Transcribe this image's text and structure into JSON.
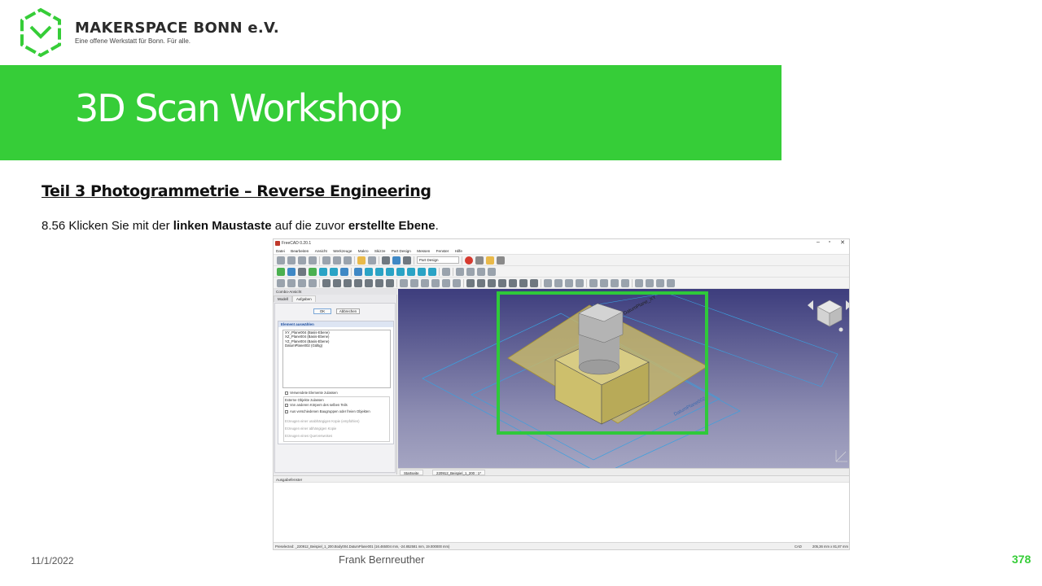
{
  "brand": {
    "name": "MAKERSPACE BONN e.V.",
    "tagline": "Eine offene Werkstatt für Bonn. Für alle.",
    "accent_color": "#36cd38"
  },
  "slide": {
    "title": "3D Scan Workshop",
    "section_heading": "Teil 3  Photogrammetrie  – Reverse Engineering",
    "instruction": {
      "part1": "8.56 Klicken Sie mit der ",
      "bold1": "linken Maustaste",
      "part2": " auf die zuvor ",
      "bold2": "erstellte Ebene",
      "part3": "."
    }
  },
  "footer": {
    "date": "11/1/2022",
    "author": "Frank Bernreuther",
    "page": "378"
  },
  "app": {
    "title": "FreeCAD 0.20.1",
    "window_buttons": [
      "–",
      "▫",
      "✕"
    ],
    "menu": [
      "Datei",
      "Bearbeiten",
      "Ansicht",
      "Werkzeuge",
      "Makro",
      "Skizze",
      "Part Design",
      "Messen",
      "Fenster",
      "Hilfe"
    ],
    "workbench": "Part Design",
    "combo_view": {
      "header": "Combo-Ansicht",
      "tabs": [
        "Modell",
        "Aufgaben"
      ],
      "ok_label": "OK",
      "cancel_label": "Abbrechen",
      "panel_title": "Element auswählen",
      "elements": [
        "XY_Plane004 (Basis-Ebene)",
        "XZ_Plane004 (Basis-Ebene)",
        "YZ_Plane004 (Basis-Ebene)",
        "DatumPlane002 (Gültig)"
      ],
      "unused_checkbox": "Verwendete Elemente zulassen",
      "external_label": "Externe Objekte zulassen",
      "other_bodies": "Von anderen Körpern des selben Teils",
      "other_parts": "Aus verschiedenen Baugruppen oder freien Objekten",
      "option_independent": "Erzeugen einer unabhängigen Kopie (empfohlen)",
      "option_dependent": "Erzeugen einer abhängigen Kopie",
      "option_crossref": "Erzeugen eines Querverweises"
    },
    "viewport": {
      "label_top": "DatumPlane_XY",
      "label_side": "DatumPlane002",
      "highlight_color": "#2fc93a"
    },
    "doc_tabs": [
      "Startseite",
      "220912_Beispiel_1_200 : 1*"
    ],
    "output_header": "Ausgabefenster",
    "status": {
      "preselected": "Preselected: _220912_Beispiel_1_200.Body004.DatumPlane001 (16.465004 mm, -24.852581 mm, 19.000000 mm)",
      "nav": "CAD",
      "dimensions": "205,36 mm x 81,87 mm"
    }
  }
}
